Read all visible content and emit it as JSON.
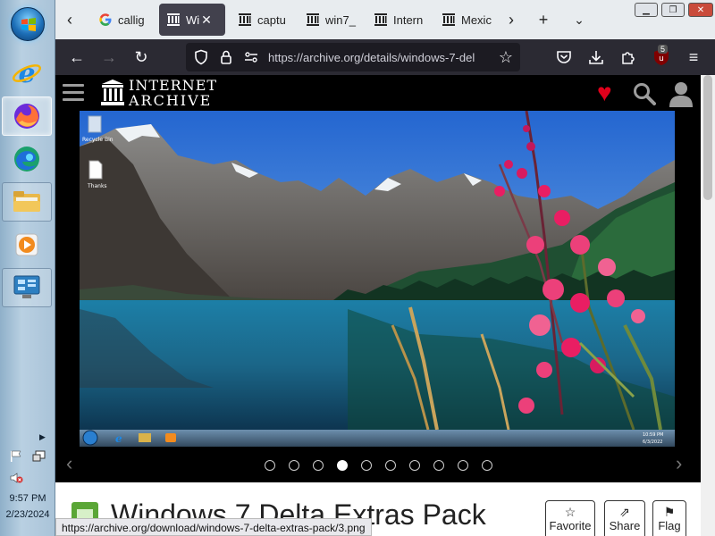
{
  "taskbar": {
    "clock_time": "9:57 PM",
    "clock_date": "2/23/2024",
    "pinned_apps": [
      "internet-explorer",
      "firefox",
      "edge",
      "file-explorer",
      "media-player",
      "control-panel"
    ]
  },
  "browser": {
    "tabs": [
      {
        "label": "callig",
        "icon": "google-icon",
        "active": false
      },
      {
        "label": "Wi",
        "icon": "archive-icon",
        "active": true
      },
      {
        "label": "captu",
        "icon": "archive-icon",
        "active": false
      },
      {
        "label": "win7_",
        "icon": "archive-icon",
        "active": false
      },
      {
        "label": "Intern",
        "icon": "archive-icon",
        "active": false
      },
      {
        "label": "Mexic",
        "icon": "archive-icon",
        "active": false
      }
    ],
    "url": "https://archive.org/details/windows-7-del",
    "extension_badge": "5",
    "status_url": "https://archive.org/download/windows-7-delta-extras-pack/3.png"
  },
  "site": {
    "logo_line1": "INTERNET",
    "logo_line2": "ARCHIVE"
  },
  "screenshot": {
    "desktop_icons": [
      "Recycle Bin",
      "Thanks"
    ],
    "clock_time": "10:59 PM",
    "clock_date": "6/3/2022"
  },
  "carousel": {
    "dot_count": 10,
    "active_index": 3
  },
  "item": {
    "title": "Windows 7 Delta Extras Pack",
    "actions": [
      {
        "label": "Favorite",
        "icon": "star-icon"
      },
      {
        "label": "Share",
        "icon": "share-icon"
      },
      {
        "label": "Flag",
        "icon": "flag-icon"
      }
    ]
  }
}
